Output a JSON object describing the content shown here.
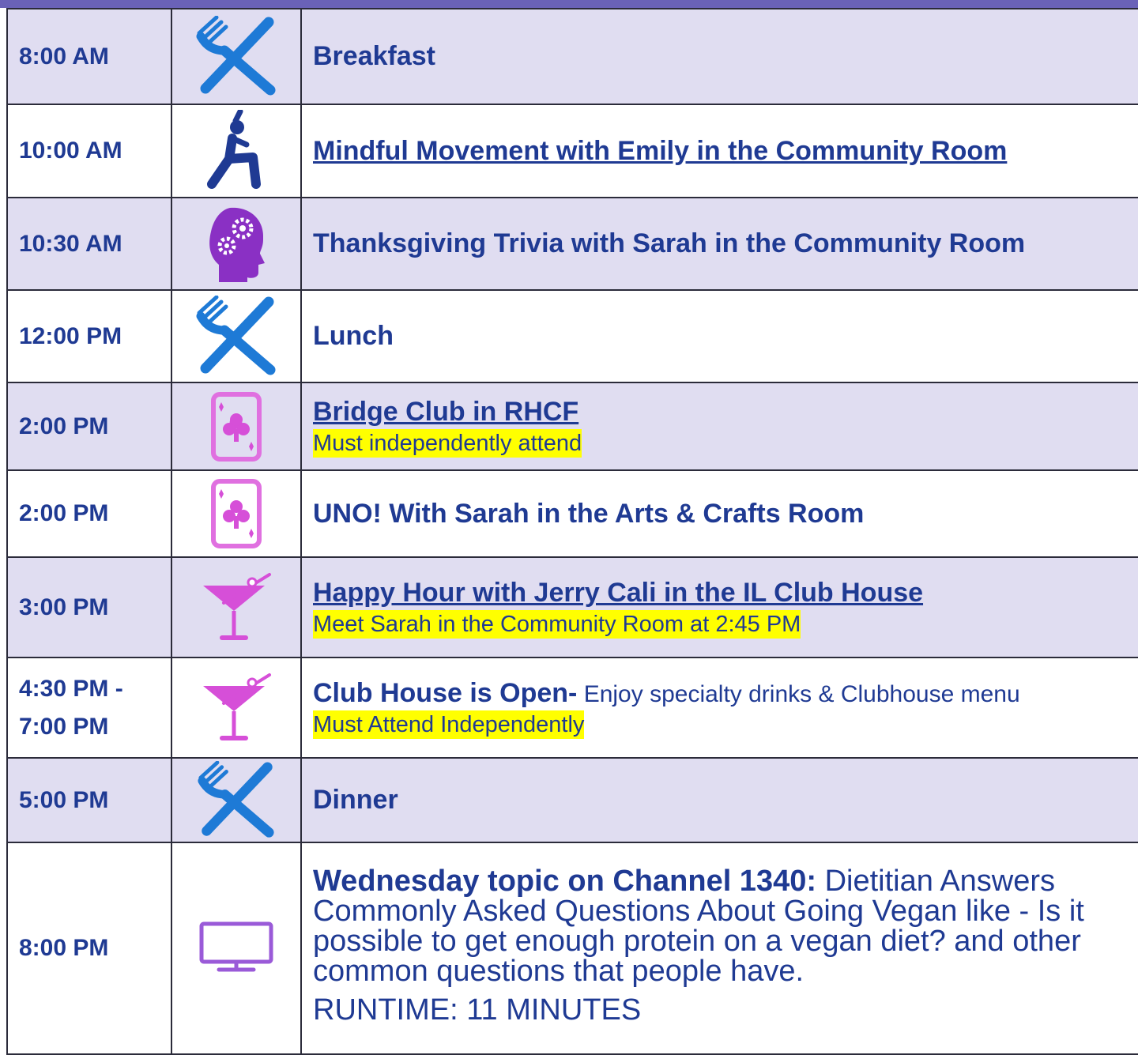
{
  "rows": [
    {
      "time": "8:00 AM",
      "icon": "fork-knife-icon",
      "title": "Breakfast"
    },
    {
      "time": "10:00 AM",
      "icon": "yoga-icon",
      "title": "Mindful Movement with Emily in the Community Room"
    },
    {
      "time": "10:30 AM",
      "icon": "brain-gears-icon",
      "title": "Thanksgiving Trivia with Sarah in the Community Room"
    },
    {
      "time": "12:00 PM",
      "icon": "fork-knife-icon",
      "title": "Lunch"
    },
    {
      "time": "2:00 PM",
      "icon": "playing-card-icon",
      "title": "Bridge Club in RHCF",
      "note": "Must independently attend"
    },
    {
      "time": "2:00 PM",
      "icon": "playing-card-icon",
      "title": "UNO! With Sarah in the Arts & Crafts Room"
    },
    {
      "time": "3:00 PM",
      "icon": "cocktail-icon",
      "title": "Happy Hour with Jerry Cali in the IL Club House",
      "note": "Meet Sarah in the Community Room at 2:45 PM"
    },
    {
      "time_line1": "4:30 PM -",
      "time_line2": "7:00 PM",
      "icon": "cocktail-icon",
      "title": "Club House is Open-",
      "detail": " Enjoy specialty drinks & Clubhouse menu",
      "note": "Must Attend Independently"
    },
    {
      "time": "5:00 PM",
      "icon": "fork-knife-icon",
      "title": "Dinner"
    },
    {
      "time": "8:00 PM",
      "icon": "tv-icon",
      "title": "Wednesday topic on Channel 1340:",
      "detail": " Dietitian Answers Commonly Asked Questions About Going Vegan like - Is it possible to get enough protein on a vegan diet? and other common questions that people have.",
      "runtime": "RUNTIME: 11 MINUTES"
    }
  ],
  "colors": {
    "header_bar": "#6a62b8",
    "row_shade": "#e0ddf1",
    "text": "#1f3a93",
    "highlight": "#ffff00",
    "fork_icon": "#1e7ad6",
    "pink_icon": "#d64fd8"
  }
}
